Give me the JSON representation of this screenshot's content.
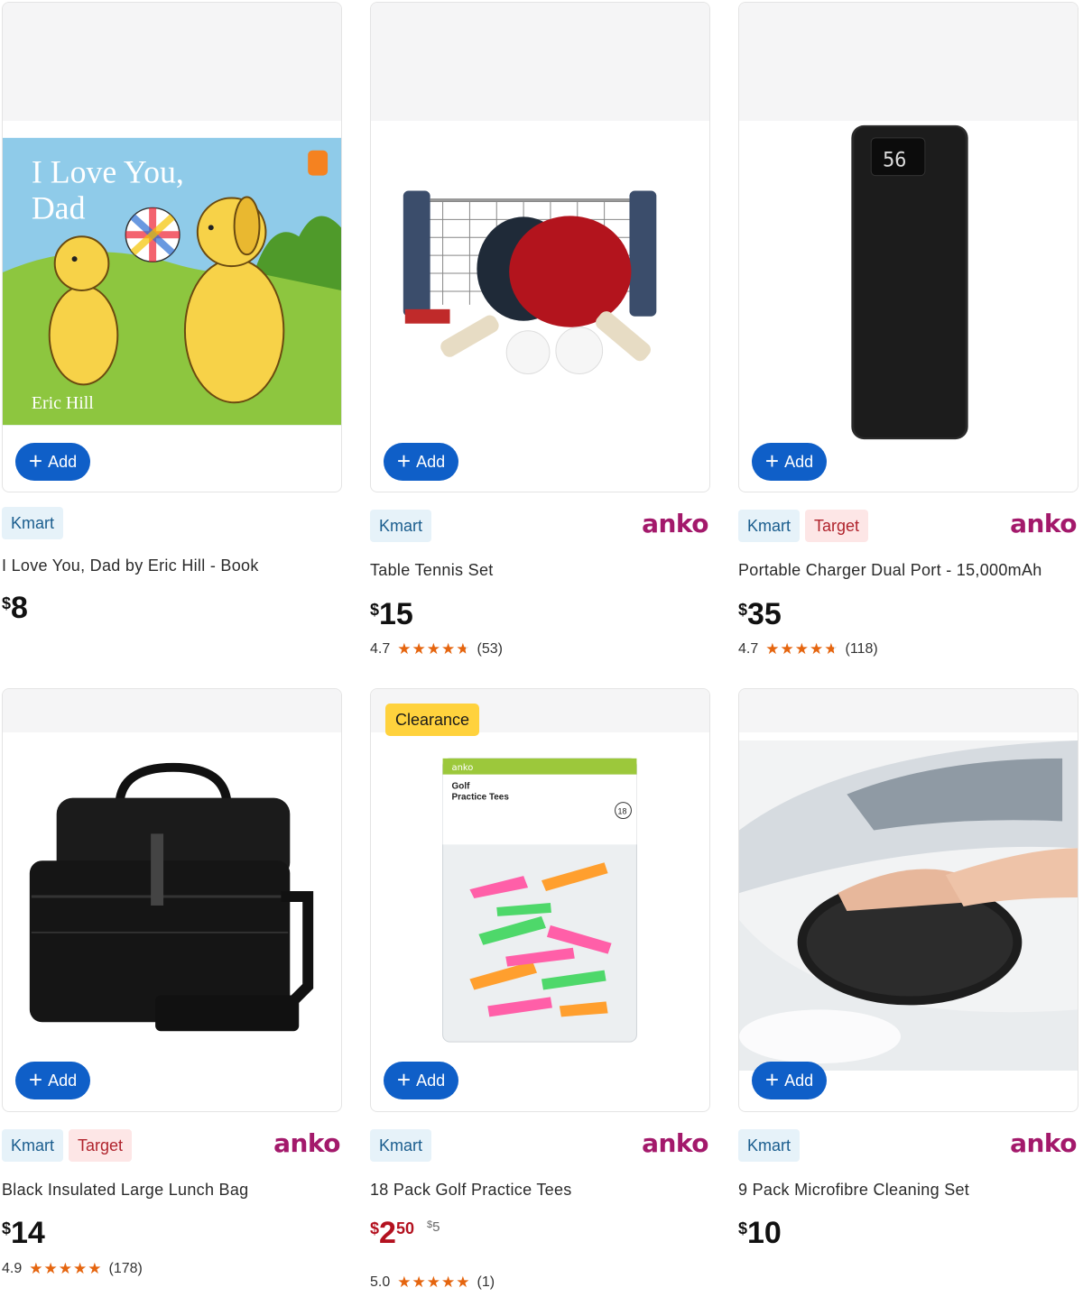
{
  "add_label": "Add",
  "clearance_label": "Clearance",
  "brand_label": "anko",
  "products": [
    {
      "title": "I Love You, Dad by Eric Hill - Book",
      "stores": [
        "Kmart"
      ],
      "price": "8",
      "book_title_line1": "I Love You,",
      "book_title_line2": "Dad",
      "book_author": "Eric Hill"
    },
    {
      "title": "Table Tennis Set",
      "stores": [
        "Kmart"
      ],
      "price": "15",
      "rating": "4.7",
      "stars": 4.7,
      "reviews": "(53)"
    },
    {
      "title": "Portable Charger Dual Port - 15,000mAh",
      "stores": [
        "Kmart",
        "Target"
      ],
      "price": "35",
      "rating": "4.7",
      "stars": 4.7,
      "reviews": "(118)",
      "screen_text": "56"
    },
    {
      "title": "Black Insulated Large Lunch Bag",
      "stores": [
        "Kmart",
        "Target"
      ],
      "price": "14",
      "rating": "4.9",
      "stars": 4.9,
      "reviews": "(178)"
    },
    {
      "title": "18 Pack Golf Practice Tees",
      "stores": [
        "Kmart"
      ],
      "price": "2",
      "price_cents": "50",
      "was_price": "5",
      "rating": "5.0",
      "stars": 5.0,
      "reviews": "(1)",
      "pack_brand": "anko",
      "pack_title_line1": "Golf",
      "pack_title_line2": "Practice Tees",
      "pack_count": "18"
    },
    {
      "title": "9 Pack Microfibre Cleaning Set",
      "stores": [
        "Kmart"
      ],
      "price": "10"
    }
  ],
  "currency_symbol": "$",
  "colors": {
    "add_button": "#0f5fc8",
    "brand": "#a3196b",
    "star": "#e5650f",
    "clearance": "#ffd23d",
    "sale_price": "#b3111f"
  }
}
